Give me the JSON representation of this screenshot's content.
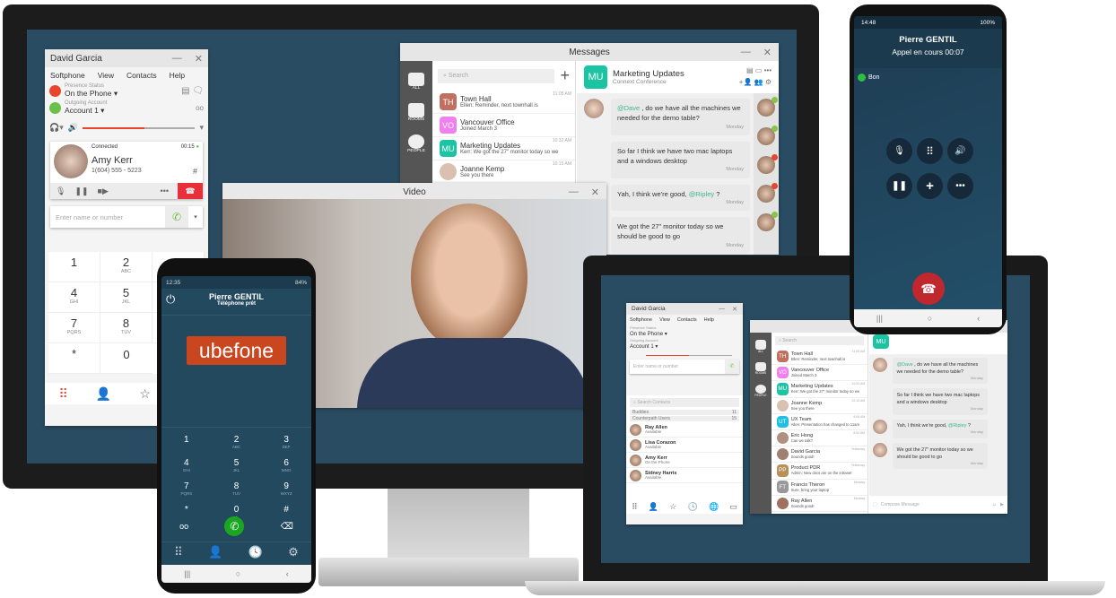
{
  "colors": {
    "desktop_bg": "#2a4c62",
    "accent": "#e8452c",
    "mention": "#3cb88e",
    "mobile_bg": "#23495f",
    "call_green": "#1aa620",
    "hangup_red": "#c0282e"
  },
  "softphone": {
    "title": "David Garcia",
    "menu": [
      "Softphone",
      "View",
      "Contacts",
      "Help"
    ],
    "presence_label": "Presence Status",
    "presence_value": "On the Phone",
    "account_label": "Outgoing Account",
    "account_value": "Account 1",
    "volume_percent": 55,
    "call": {
      "status": "Connected",
      "timer": "00:15",
      "name": "Amy Kerr",
      "number": "1(604) 555 - 5223",
      "hash": "#"
    },
    "dial_placeholder": "Enter name or number",
    "keys": [
      [
        "1",
        ""
      ],
      [
        "2",
        "ABC"
      ],
      [
        "3",
        "DEF"
      ],
      [
        "4",
        "GHI"
      ],
      [
        "5",
        "JKL"
      ],
      [
        "6",
        "MNO"
      ],
      [
        "7",
        "PQRS"
      ],
      [
        "8",
        "TUV"
      ],
      [
        "9",
        "WXYZ"
      ],
      [
        "*",
        ""
      ],
      [
        "0",
        ""
      ],
      [
        "#",
        ""
      ]
    ]
  },
  "messages": {
    "title": "Messages",
    "nav": [
      "ALL",
      "ROOMS",
      "PEOPLE"
    ],
    "search_placeholder": "Search",
    "conversations": [
      {
        "initials": "TH",
        "color": "#c07060",
        "name": "Town Hall",
        "preview": "Ellen: Reminder, next townhall is",
        "time": "11:05 AM"
      },
      {
        "initials": "VO",
        "color": "#f07ff0",
        "name": "Vancouver Office",
        "preview": "Joined March 3",
        "time": ""
      },
      {
        "initials": "MU",
        "color": "#1cc4a4",
        "name": "Marketing Updates",
        "preview": "Kerr: We got the 27\" monitor today so we",
        "time": "10:32 AM"
      },
      {
        "initials": "",
        "color": "#d9c0b0",
        "name": "Joanne Kemp",
        "preview": "See you there",
        "time": "10:15 AM"
      }
    ],
    "chat": {
      "initials": "MU",
      "name": "Marketing Updates",
      "subtitle": "Connext Conference",
      "messages": [
        {
          "mention": "@Dave",
          "text": " , do we have all the machines we needed for the demo table?",
          "date": "Monday"
        },
        {
          "mention": "",
          "text": "So far I think we have two mac laptops and a windows desktop",
          "date": "Monday"
        },
        {
          "mention": "",
          "text": "Yah, I think we're good, ",
          "mention_after": "@Ripley",
          "tail": " ?",
          "date": "Monday"
        },
        {
          "mention": "",
          "text": "We got the 27\" monitor today so we should be good to go",
          "date": "Monday"
        }
      ]
    }
  },
  "video": {
    "title": "Video"
  },
  "phone_left": {
    "time": "12:35",
    "battery": "84%",
    "name": "Pierre GENTIL",
    "status": "Téléphone prêt",
    "logo": "ubefone",
    "keys": [
      [
        "1",
        ""
      ],
      [
        "2",
        "ABC"
      ],
      [
        "3",
        "DEF"
      ],
      [
        "4",
        "GHI"
      ],
      [
        "5",
        "JKL"
      ],
      [
        "6",
        "MNO"
      ],
      [
        "7",
        "PQRS"
      ],
      [
        "8",
        "TUV"
      ],
      [
        "9",
        "WXYZ"
      ],
      [
        "*",
        ""
      ],
      [
        "0",
        "+"
      ],
      [
        "#",
        ""
      ]
    ]
  },
  "phone_right": {
    "time": "14:48",
    "battery": "100%",
    "name": "Pierre GENTIL",
    "status": "Appel en cours",
    "timer": "00:07",
    "quality": "Bon"
  },
  "laptop": {
    "softphone": {
      "title": "David Garcia",
      "menu": [
        "Softphone",
        "View",
        "Contacts",
        "Help"
      ],
      "presence_label": "Presence Status",
      "presence_value": "On the Phone",
      "account_label": "Outgoing Account",
      "account_value": "Account 1",
      "dial_placeholder": "Enter name or number",
      "search_placeholder": "Search Contacts",
      "groups": [
        {
          "name": "Buddies",
          "count": "11"
        },
        {
          "name": "Counterpath Users",
          "count": "15"
        }
      ],
      "contacts": [
        {
          "name": "Ray Allen",
          "status": "Available"
        },
        {
          "name": "Lisa Corazon",
          "status": "Available"
        },
        {
          "name": "Amy Kerr",
          "status": "On the Phone"
        },
        {
          "name": "Sidney Harris",
          "status": "Available"
        }
      ]
    },
    "messages": {
      "search_placeholder": "Search",
      "nav": [
        "ALL",
        "ROOMS",
        "PEOPLE"
      ],
      "compose_placeholder": "Compose Message",
      "conversations": [
        {
          "initials": "TH",
          "color": "#c07060",
          "name": "Town Hall",
          "preview": "Ellen: Reminder, next townhall is",
          "time": "11:05 AM"
        },
        {
          "initials": "VO",
          "color": "#f07ff0",
          "name": "Vancouver Office",
          "preview": "Joined March 3",
          "time": ""
        },
        {
          "initials": "MU",
          "color": "#1cc4a4",
          "name": "Marketing Updates",
          "preview": "Kerr: We got the 27\" monitor today so we",
          "time": "10:32 AM"
        },
        {
          "initials": "",
          "color": "#d9c0b0",
          "name": "Joanne Kemp",
          "preview": "See you there",
          "time": "10:15 AM"
        },
        {
          "initials": "UT",
          "color": "#22c0e0",
          "name": "UX Team",
          "preview": "Allen: Presentation has changed to 11am",
          "time": "9:06 AM"
        },
        {
          "initials": "",
          "color": "#b09080",
          "name": "Eric Hong",
          "preview": "Can we talk?",
          "time": "8:52 AM"
        },
        {
          "initials": "",
          "color": "#a08070",
          "name": "David Garcia",
          "preview": "Sounds good!",
          "time": "Yesterday"
        },
        {
          "initials": "PP",
          "color": "#b8905a",
          "name": "Product PDR",
          "preview": "Admin: New docs are on the intranet",
          "time": "Yesterday"
        },
        {
          "initials": "FT",
          "color": "#999999",
          "name": "Francis Theron",
          "preview": "Sure, bring your laptop",
          "time": "Monday"
        },
        {
          "initials": "",
          "color": "#a07060",
          "name": "Ray Allen",
          "preview": "Sounds good!",
          "time": "Monday"
        }
      ]
    }
  }
}
